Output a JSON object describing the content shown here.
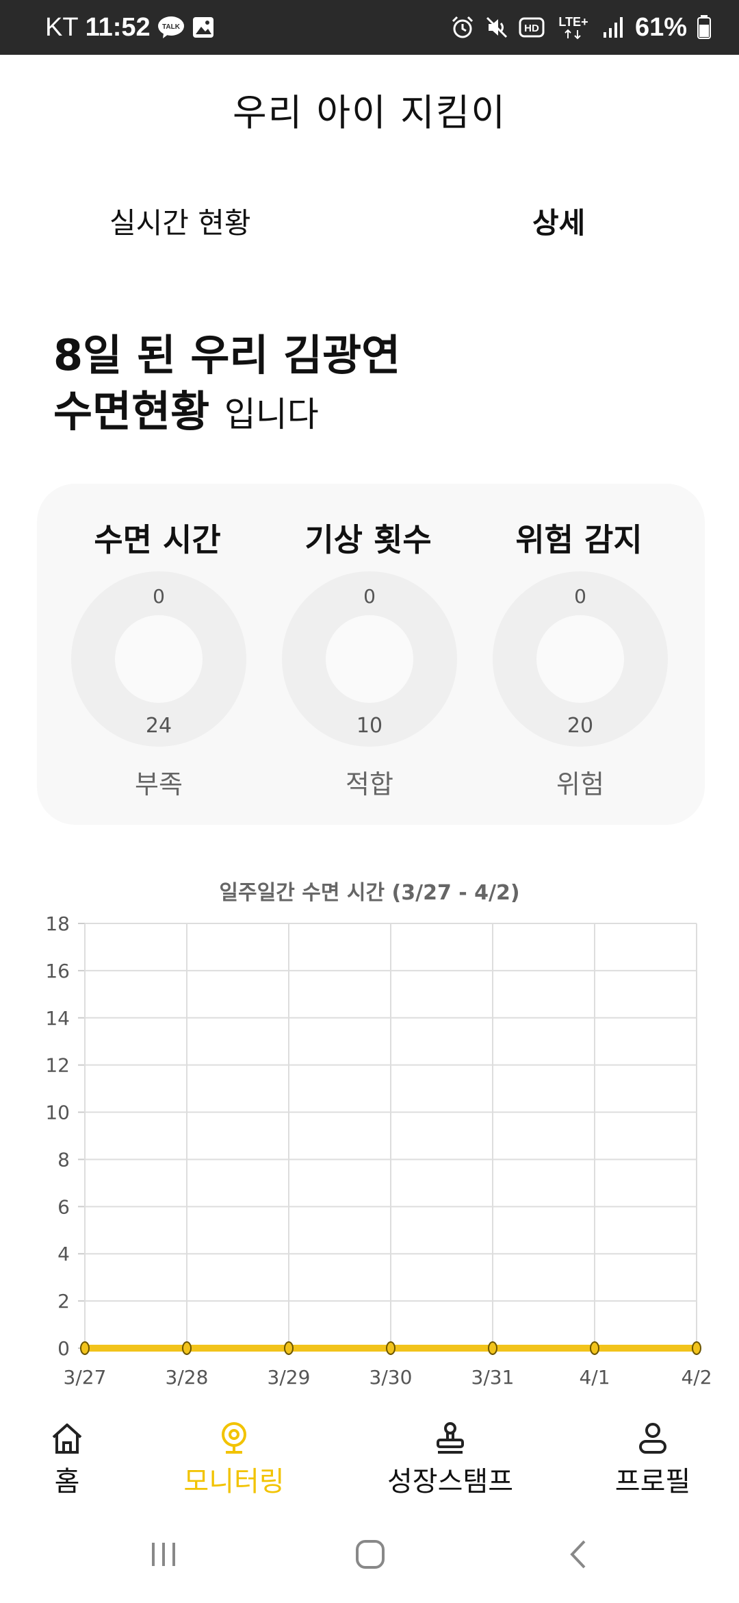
{
  "status_bar": {
    "carrier": "KT",
    "time": "11:52",
    "talk_badge": "TALK",
    "network": "LTE+",
    "battery": "61%"
  },
  "app": {
    "title": "우리 아이 지킴이"
  },
  "tabs": [
    {
      "label": "실시간 현황",
      "active": false
    },
    {
      "label": "상세",
      "active": true
    }
  ],
  "headline": {
    "line1": "8일 된 우리 김광연",
    "line2_main": "수면현황",
    "line2_suffix": "입니다"
  },
  "summary": {
    "metrics": [
      {
        "title": "수면 시간",
        "min": "0",
        "max": "24",
        "status": "부족"
      },
      {
        "title": "기상 횟수",
        "min": "0",
        "max": "10",
        "status": "적합"
      },
      {
        "title": "위험 감지",
        "min": "0",
        "max": "20",
        "status": "위험"
      }
    ]
  },
  "chart_data": {
    "type": "line",
    "title": "일주일간 수면 시간 (3/27 - 4/2)",
    "categories": [
      "3/27",
      "3/28",
      "3/29",
      "3/30",
      "3/31",
      "4/1",
      "4/2"
    ],
    "series": [
      {
        "values": [
          0,
          0,
          0,
          0,
          0,
          0,
          0
        ],
        "color": "#f2c31b"
      }
    ],
    "ylim": [
      0,
      18
    ],
    "yticks": [
      0,
      2,
      4,
      6,
      8,
      10,
      12,
      14,
      16,
      18
    ],
    "grid": true,
    "xlabel": "",
    "ylabel": ""
  },
  "bottom_nav": {
    "items": [
      {
        "label": "홈",
        "icon": "home-icon",
        "active": false
      },
      {
        "label": "모니터링",
        "icon": "webcam-icon",
        "active": true
      },
      {
        "label": "성장스탬프",
        "icon": "stamp-icon",
        "active": false
      },
      {
        "label": "프로필",
        "icon": "person-icon",
        "active": false
      }
    ],
    "active_color": "#f2c300"
  }
}
